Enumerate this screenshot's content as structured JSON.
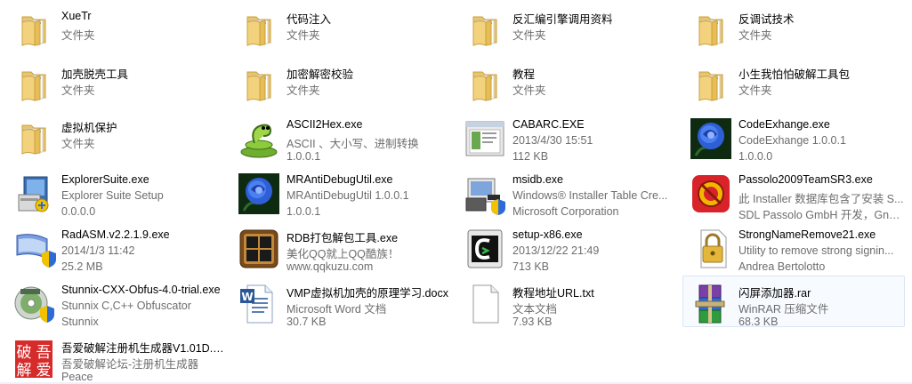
{
  "items": [
    {
      "name": "XueTr",
      "lines": [
        "文件夹"
      ],
      "icon": "folder-icon"
    },
    {
      "name": "加壳脱壳工具",
      "lines": [
        "文件夹"
      ],
      "icon": "folder-icon"
    },
    {
      "name": "虚拟机保护",
      "lines": [
        "文件夹"
      ],
      "icon": "folder-icon"
    },
    {
      "name": "ExplorerSuite.exe",
      "lines": [
        "Explorer Suite Setup",
        "0.0.0.0"
      ],
      "icon": "installer-icon"
    },
    {
      "name": "RadASM.v2.2.1.9.exe",
      "lines": [
        "2014/1/3 11:42",
        "25.2 MB"
      ],
      "icon": "app-window-shield-icon"
    },
    {
      "name": "Stunnix-CXX-Obfus-4.0-trial.exe",
      "lines": [
        "Stunnix C,C++ Obfuscator",
        "Stunnix"
      ],
      "icon": "disc-shield-icon"
    },
    {
      "name": "吾爱破解注册机生成器V1.01D.exe",
      "lines": [
        "吾爱破解论坛-注册机生成器",
        "Peace"
      ],
      "icon": "seal-icon"
    },
    {
      "name": "代码注入",
      "lines": [
        "文件夹"
      ],
      "icon": "folder-icon"
    },
    {
      "name": "加密解密校验",
      "lines": [
        "文件夹"
      ],
      "icon": "folder-icon"
    },
    {
      "name": "ASCII2Hex.exe",
      "lines": [
        "ASCII 、大小写、进制转换",
        "1.0.0.1"
      ],
      "icon": "snake-icon"
    },
    {
      "name": "MRAntiDebugUtil.exe",
      "lines": [
        "MRAntiDebugUtil 1.0.0.1",
        "1.0.0.1"
      ],
      "icon": "blue-rose-icon"
    },
    {
      "name": "RDB打包解包工具.exe",
      "lines": [
        "美化QQ就上QQ酷族！",
        "www.qqkuzu.com"
      ],
      "icon": "grid-box-icon"
    },
    {
      "name": "VMP虚拟机加壳的原理学习.docx",
      "lines": [
        "Microsoft Word 文档",
        "30.7 KB"
      ],
      "icon": "word-document-icon"
    },
    {
      "name": "反汇编引擎调用资料",
      "lines": [
        "文件夹"
      ],
      "icon": "folder-icon"
    },
    {
      "name": "教程",
      "lines": [
        "文件夹"
      ],
      "icon": "folder-icon"
    },
    {
      "name": "CABARC.EXE",
      "lines": [
        "2013/4/30 15:51",
        "112 KB"
      ],
      "icon": "console-window-icon"
    },
    {
      "name": "msidb.exe",
      "lines": [
        "Windows® Installer Table Cre...",
        "Microsoft Corporation"
      ],
      "icon": "msi-installer-icon"
    },
    {
      "name": "setup-x86.exe",
      "lines": [
        "2013/12/22 21:49",
        "713 KB"
      ],
      "icon": "cygwin-icon"
    },
    {
      "name": "教程地址URL.txt",
      "lines": [
        "文本文档",
        "7.93 KB"
      ],
      "icon": "text-file-icon"
    },
    {
      "name": "反调试技术",
      "lines": [
        "文件夹"
      ],
      "icon": "folder-icon"
    },
    {
      "name": "小生我怕怕破解工具包",
      "lines": [
        "文件夹"
      ],
      "icon": "folder-icon"
    },
    {
      "name": "CodeExhange.exe",
      "lines": [
        "CodeExhange 1.0.0.1",
        "1.0.0.0"
      ],
      "icon": "blue-rose-icon"
    },
    {
      "name": "Passolo2009TeamSR3.exe",
      "lines": [
        "此 Installer 数据库包含了安装 S...",
        "SDL Passolo GmbH 开发，Gna..."
      ],
      "icon": "passolo-icon"
    },
    {
      "name": "StrongNameRemove21.exe",
      "lines": [
        "Utility to remove strong signin...",
        "Andrea Bertolotto"
      ],
      "icon": "padlock-file-icon"
    },
    {
      "name": "闪屏添加器.rar",
      "lines": [
        "WinRAR 压缩文件",
        "68.3 KB"
      ],
      "icon": "winrar-archive-icon",
      "selected": true
    }
  ]
}
